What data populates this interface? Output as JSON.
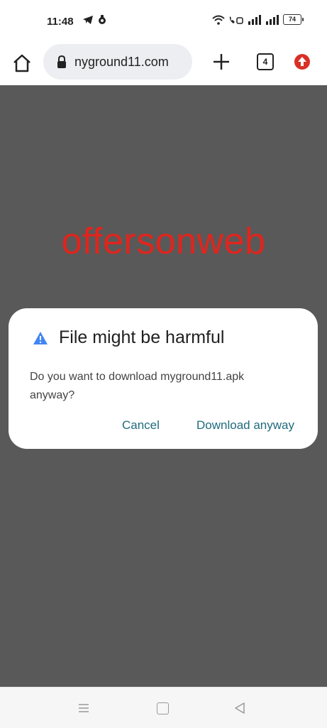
{
  "status_bar": {
    "time": "11:48",
    "battery": "74"
  },
  "toolbar": {
    "url": "nyground11.com",
    "tab_count": "4"
  },
  "page": {
    "watermark": "offersonweb"
  },
  "dialog": {
    "title": "File might be harmful",
    "message_line1": "Do you want to download myground11.apk",
    "message_line2": "anyway?",
    "cancel_label": "Cancel",
    "download_label": "Download anyway"
  },
  "colors": {
    "watermark": "#e0251d",
    "dialog_button": "#1f6b7d",
    "page_background": "#595959",
    "warning_icon": "#4285f4"
  },
  "icons": [
    "telegram-icon",
    "notification-icon",
    "wifi-icon",
    "volte-icon",
    "signal-icon",
    "battery-icon",
    "home-icon",
    "lock-icon",
    "plus-icon",
    "tab-switcher-icon",
    "update-icon",
    "warning-icon",
    "menu-icon",
    "square-icon",
    "back-icon"
  ]
}
